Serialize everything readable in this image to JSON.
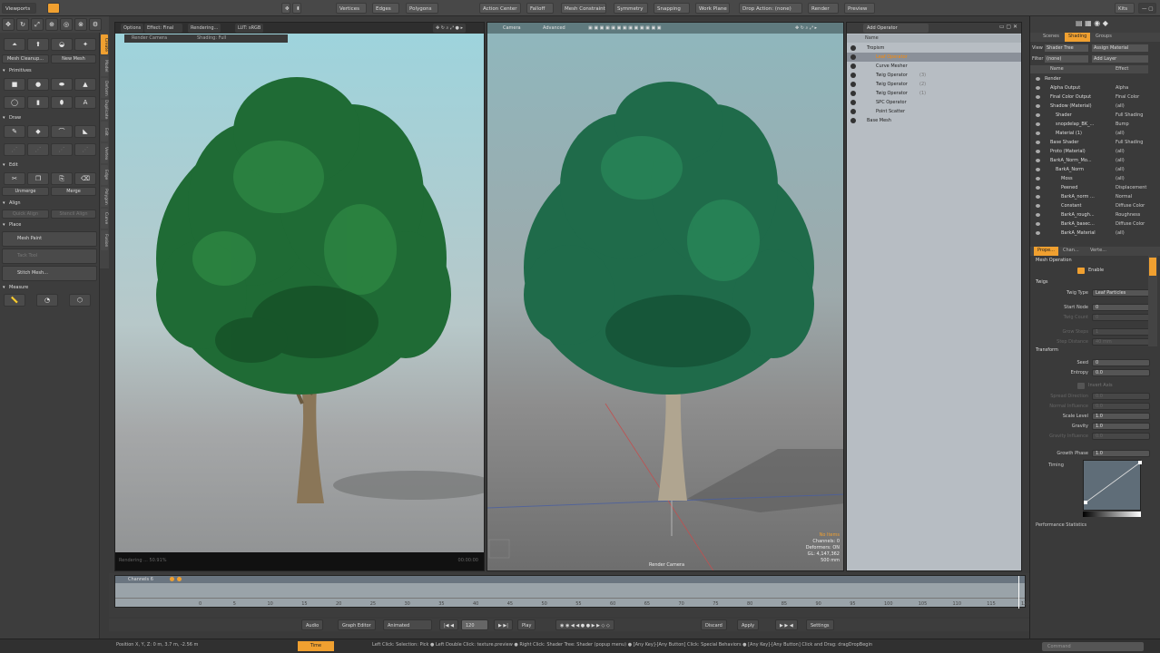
{
  "topbar": {
    "viewports": "Viewports",
    "vertices": "Vertices",
    "edges": "Edges",
    "polygons": "Polygons",
    "action_center": "Action Center",
    "falloff": "Falloff",
    "mesh_constraint": "Mesh Constraint",
    "symmetry": "Symmetry",
    "snapping": "Snapping",
    "work_plane": "Work Plane",
    "drop_action": "Drop Action: (none)",
    "render": "Render",
    "preview": "Preview",
    "user": "Kits"
  },
  "left_tools": {
    "mesh_cleanup": "Mesh Cleanup...",
    "new_mesh": "New Mesh",
    "primitives": "Primitives",
    "draw": "Draw",
    "edit": "Edit",
    "unmerge": "Unmerge",
    "merge": "Merge",
    "align": "Align",
    "quick_align": "Quick Align",
    "stencil_align": "Stencil Align",
    "place": "Place",
    "mesh_paint": "Mesh Paint",
    "tack_tool": "Tack Tool",
    "stitch_mesh": "Stitch Mesh...",
    "measure": "Measure"
  },
  "vtabs": [
    "Create",
    "Model",
    "Deform",
    "Duplicate",
    "Edit",
    "Vertex",
    "Edge",
    "Polygon",
    "Curve",
    "Fusion"
  ],
  "viewport_left": {
    "options": "Options",
    "effect": "Effect: Final C...",
    "rendering": "Rendering...",
    "lut": "LUT: sRGB",
    "render_camera": "Render Camera",
    "shading": "Shading: Full",
    "status": "Rendering ... 50.91%",
    "time": "00:00:00"
  },
  "viewport_right": {
    "camera": "Camera",
    "advanced": "Advanced",
    "no_items": "No Items",
    "channels": "Channels: 0",
    "deformers": "Deformers: ON",
    "gl": "GL: 4,147,362",
    "dist": "500 mm",
    "label": "Render Camera"
  },
  "items_panel": {
    "add_operator": "Add Operator",
    "header": "Name",
    "rows": [
      {
        "name": "Tropism",
        "indent": 0
      },
      {
        "name": "Leaf Operator",
        "indent": 1,
        "highlight": true
      },
      {
        "name": "Curve Mesher",
        "indent": 1
      },
      {
        "name": "Twig Operator",
        "indent": 1,
        "suffix": "(3)"
      },
      {
        "name": "Twig Operator",
        "indent": 1,
        "suffix": "(2)"
      },
      {
        "name": "Twig Operator",
        "indent": 1,
        "suffix": "(1)"
      },
      {
        "name": "SPC Operator",
        "indent": 1
      },
      {
        "name": "Point Scatter",
        "indent": 1
      },
      {
        "name": "Base Mesh",
        "indent": 0
      }
    ]
  },
  "shader_tree": {
    "tabs": [
      "Scenes",
      "Shading",
      "Groups"
    ],
    "view_label": "View",
    "view_value": "Shader Tree",
    "assign_material": "Assign Material",
    "filter_label": "Filter",
    "filter_value": "(none)",
    "add_layer": "Add Layer",
    "col_name": "Name",
    "col_effect": "Effect",
    "rows": [
      {
        "name": "Render",
        "effect": ""
      },
      {
        "name": "Alpha Output",
        "effect": "Alpha"
      },
      {
        "name": "Final Color Output",
        "effect": "Final Color"
      },
      {
        "name": "Shadow (Material)",
        "effect": "(all)"
      },
      {
        "name": "Shader",
        "effect": "Full Shading"
      },
      {
        "name": "snopdelap_BK_...",
        "effect": "Bump"
      },
      {
        "name": "Material (1)",
        "effect": "(all)"
      },
      {
        "name": "Base Shader",
        "effect": "Full Shading"
      },
      {
        "name": "Proto (Material)",
        "effect": "(all)"
      },
      {
        "name": "BarkA_Norm_Mo...",
        "effect": "(all)"
      },
      {
        "name": "BarkA_Norm",
        "effect": "(all)"
      },
      {
        "name": "Moss",
        "effect": "(all)"
      },
      {
        "name": "Peened",
        "effect": "Displacement"
      },
      {
        "name": "BarkA_norm ...",
        "effect": "Normal"
      },
      {
        "name": "Constant",
        "effect": "Diffuse Color"
      },
      {
        "name": "BarkA_rough...",
        "effect": "Roughness"
      },
      {
        "name": "BarkA_basec...",
        "effect": "Diffuse Color"
      },
      {
        "name": "BarkA_Material",
        "effect": "(all)"
      }
    ]
  },
  "properties": {
    "tabs": [
      "Prope...",
      "Chan...",
      "Verte..."
    ],
    "section": "Mesh Operation",
    "enable": "Enable",
    "twigs": "Twigs",
    "transform": "Transform",
    "timing": "Timing",
    "perf": "Performance Statistics",
    "invert_axis": "Invert Axis",
    "fields": [
      {
        "label": "Twig Type",
        "value": "Leaf Particles",
        "dim": false
      },
      {
        "label": "Start Node",
        "value": "0",
        "dim": false
      },
      {
        "label": "Twig Count",
        "value": "0",
        "dim": true
      },
      {
        "label": "Grow Steps",
        "value": "1",
        "dim": true
      },
      {
        "label": "Step Distance",
        "value": "40 mm",
        "dim": true
      },
      {
        "label": "Seed",
        "value": "0",
        "dim": false
      },
      {
        "label": "Entropy",
        "value": "0.0",
        "dim": false
      },
      {
        "label": "Spread Direction",
        "value": "0.0",
        "dim": true
      },
      {
        "label": "Normal Influence",
        "value": "0.0",
        "dim": true
      },
      {
        "label": "Scale Level",
        "value": "1.0",
        "dim": false
      },
      {
        "label": "Gravity",
        "value": "1.0",
        "dim": false
      },
      {
        "label": "Gravity Influence",
        "value": "0.0",
        "dim": true
      },
      {
        "label": "Growth Phase",
        "value": "1.0",
        "dim": false
      }
    ]
  },
  "timeline": {
    "channels": "Channels 6",
    "ticks": [
      "0",
      "5",
      "10",
      "15",
      "20",
      "25",
      "30",
      "35",
      "40",
      "45",
      "50",
      "55",
      "60",
      "65",
      "70",
      "75",
      "80",
      "85",
      "90",
      "95",
      "100",
      "105",
      "110",
      "115",
      "120"
    ]
  },
  "transport": {
    "audio": "Audio",
    "graph_editor": "Graph Editor",
    "animated": "Animated",
    "frame": "120",
    "play": "Play",
    "discard": "Discard",
    "apply": "Apply",
    "settings": "Settings"
  },
  "status": {
    "position": "Position X, Y, Z:  0 m, 3.7 m, -2.56 m",
    "time": "Time",
    "hint": "Left Click: Selection: Pick ● Left Double Click: texture.preview ● Right Click: Shader Tree: Shader (popup menu) ● [Any Key]-[Any Button] Click: Special Behaviors ● [Any Key]-[Any Button] Click and Drag: dragDropBegin",
    "command": "Command"
  },
  "colors": {
    "accent": "#f0a030",
    "highlight_row": "#ff8a00",
    "leaf": "#1f6b35"
  }
}
